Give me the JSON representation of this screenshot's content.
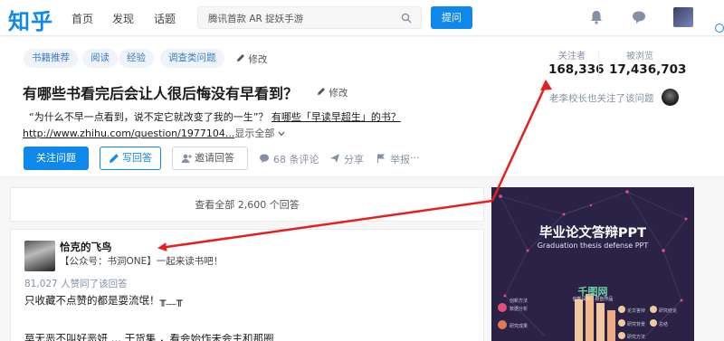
{
  "topnav": {
    "logo": "知乎",
    "links": [
      "首页",
      "发现",
      "话题"
    ],
    "search_placeholder": "腾讯首款 AR 捉妖手游",
    "ask_label": "提问",
    "icons": [
      "bell-icon",
      "message-icon",
      "avatar"
    ]
  },
  "question": {
    "tags": [
      "书籍推荐",
      "阅读",
      "经验",
      "调查类问题"
    ],
    "tags_modify": "修改",
    "title": "有哪些书看完后会让人很后悔没有早看到？",
    "title_modify": "修改",
    "excerpt_quote": "“为什么不早一点看到，说不定它就改变了我的一生”",
    "excerpt_mid": "？",
    "excerpt_link": "有哪些「早读早超生」的书？",
    "url_text": "http://www.zhihu.com/question/1977104...",
    "show_all": "显示全部",
    "follow_button": "关注问题",
    "write_button": "写回答",
    "invite_button": "邀请回答",
    "comments": "68 条评论",
    "share": "分享",
    "report": "举报",
    "more": "···"
  },
  "stats": {
    "followers_label": "关注者",
    "followers": "168,336",
    "views_label": "被浏览",
    "views": "17,436,703",
    "followed_by": "老李校长也关注了该问题"
  },
  "answers": {
    "view_all": "查看全部 2,600 个回答",
    "first": {
      "author": "恰克的飞鸟",
      "bio": "【公众号：书洞ONE】一起来读书吧！",
      "votes": "81,027 人赞同了该回答",
      "text": "只收藏不点赞的都是耍流氓！╥﹏╥",
      "text_cut": "莫无恶不叫好恶妍 … 干货集 ，看会始作未会主和那圈"
    }
  },
  "ad": {
    "title": "毕业论文答辩PPT",
    "subtitle": "Graduation thesis defense PPT",
    "brand": "千图网",
    "brand_sub": "创新设计 · 原创作品",
    "left_labels": [
      "创新方法",
      "数据分析",
      "研究成果"
    ],
    "right_labels": [
      "论文答辩",
      "研究背景",
      "研究方法",
      "研究结论",
      "总结"
    ],
    "colors": {
      "bg": "#2a2346",
      "bar": "#f2c8a0",
      "dot": "#e0507a"
    }
  },
  "colors": {
    "brand": "#0f88eb",
    "arrow": "#e41f1f"
  }
}
